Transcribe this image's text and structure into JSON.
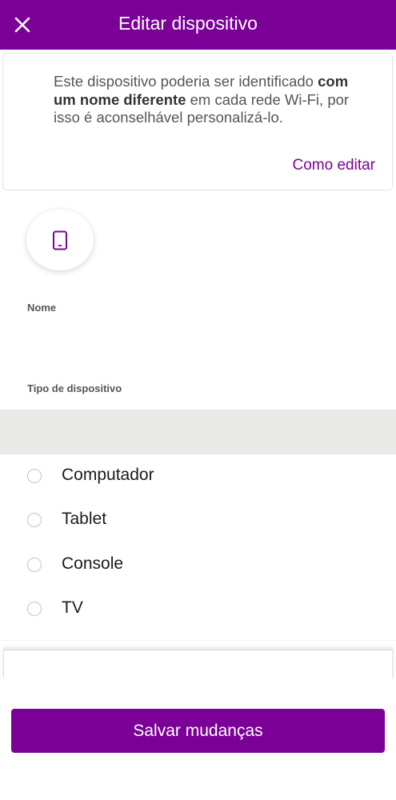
{
  "header": {
    "title": "Editar dispositivo",
    "close_icon": "close-icon"
  },
  "info": {
    "text_before": "Este dispositivo poderia ser identificado ",
    "text_bold": "com um nome diferente",
    "text_after": " em cada rede Wi-Fi, por isso é aconselhável personalizá-lo.",
    "link": "Como editar"
  },
  "device": {
    "icon": "tablet-icon"
  },
  "form": {
    "name_label": "Nome",
    "name_value": "",
    "type_label": "Tipo de dispositivo"
  },
  "device_types": [
    {
      "label": "Computador",
      "selected": false
    },
    {
      "label": "Tablet",
      "selected": false
    },
    {
      "label": "Console",
      "selected": false
    },
    {
      "label": "TV",
      "selected": false
    }
  ],
  "footer": {
    "save_label": "Salvar mudanças"
  },
  "colors": {
    "brand": "#7a0098",
    "band": "#e9e9e8"
  }
}
